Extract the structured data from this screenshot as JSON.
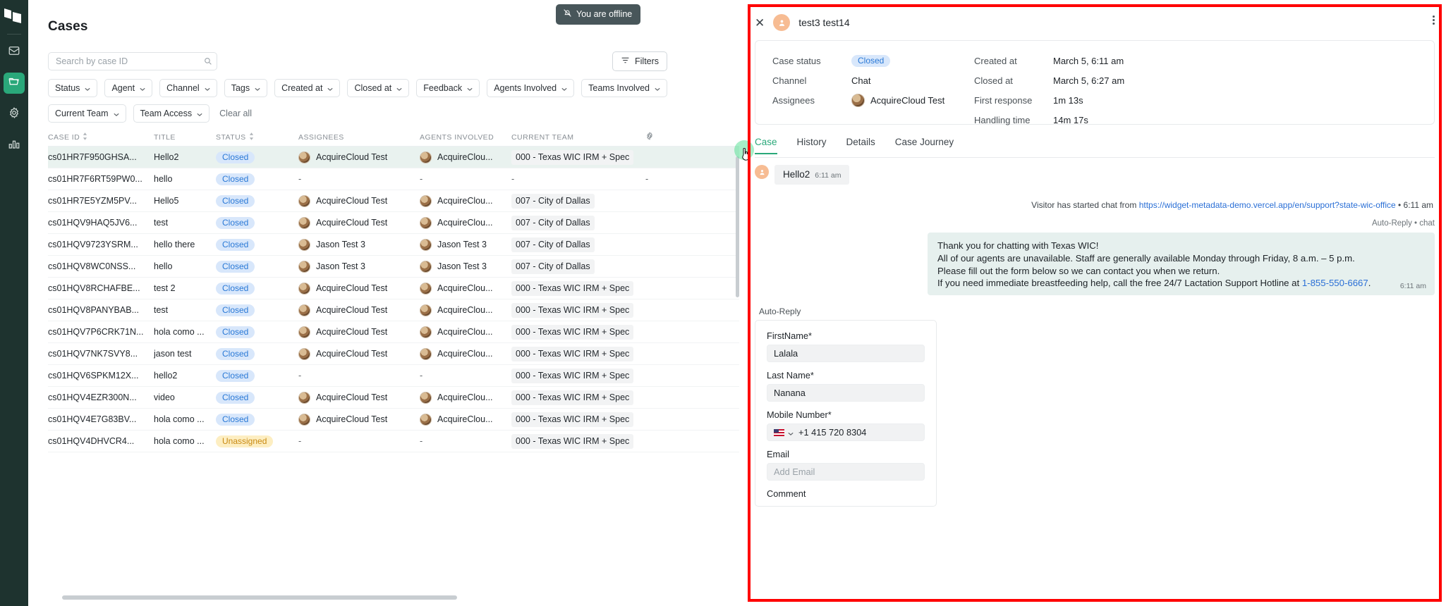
{
  "app": {
    "logo_icon": "acquire-logo-icon",
    "rail_items": [
      {
        "name": "inbox",
        "icon": "envelope-icon",
        "active": false
      },
      {
        "name": "cases",
        "icon": "folder-open-icon",
        "active": true
      },
      {
        "name": "settings",
        "icon": "gear-icon",
        "active": false
      },
      {
        "name": "analytics",
        "icon": "bar-chart-icon",
        "active": false
      }
    ]
  },
  "header": {
    "title": "Cases",
    "offline_label": "You are offline",
    "offline_icon": "bell-slash-icon"
  },
  "search": {
    "placeholder": "Search by case ID",
    "value": "",
    "icon": "search-icon"
  },
  "filters_button": {
    "label": "Filters",
    "icon": "filter-icon"
  },
  "filter_chips_row1": [
    "Status",
    "Agent",
    "Channel",
    "Tags",
    "Created at",
    "Closed at",
    "Feedback",
    "Agents Involved",
    "Teams Involved"
  ],
  "filter_chips_row2": [
    "Current Team",
    "Team Access"
  ],
  "clear_all_label": "Clear all",
  "table": {
    "columns": [
      "CASE ID",
      "TITLE",
      "STATUS",
      "ASSIGNEES",
      "AGENTS INVOLVED",
      "CURRENT TEAM"
    ],
    "sortable": [
      "CASE ID",
      "STATUS"
    ],
    "settings_icon": "gear-icon",
    "rows": [
      {
        "id": "cs01HR7F950GHSA...",
        "title": "Hello2",
        "status": "Closed",
        "assignee": "AcquireCloud Test",
        "agent": "AcquireClou...",
        "team": "000 - Texas WIC IRM + Spec",
        "selected": true
      },
      {
        "id": "cs01HR7F6RT59PW0...",
        "title": "hello",
        "status": "Closed",
        "assignee": "-",
        "agent": "-",
        "team": "-",
        "selected": false
      },
      {
        "id": "cs01HR7E5YZM5PV...",
        "title": "Hello5",
        "status": "Closed",
        "assignee": "AcquireCloud Test",
        "agent": "AcquireClou...",
        "team": "007 - City of Dallas",
        "selected": false
      },
      {
        "id": "cs01HQV9HAQ5JV6...",
        "title": "test",
        "status": "Closed",
        "assignee": "AcquireCloud Test",
        "agent": "AcquireClou...",
        "team": "007 - City of Dallas",
        "selected": false
      },
      {
        "id": "cs01HQV9723YSRM...",
        "title": "hello there",
        "status": "Closed",
        "assignee": "Jason Test 3",
        "agent": "Jason Test 3",
        "team": "007 - City of Dallas",
        "selected": false
      },
      {
        "id": "cs01HQV8WC0NSS...",
        "title": "hello",
        "status": "Closed",
        "assignee": "Jason Test 3",
        "agent": "Jason Test 3",
        "team": "007 - City of Dallas",
        "selected": false
      },
      {
        "id": "cs01HQV8RCHAFBE...",
        "title": "test 2",
        "status": "Closed",
        "assignee": "AcquireCloud Test",
        "agent": "AcquireClou...",
        "team": "000 - Texas WIC IRM + Spec",
        "selected": false
      },
      {
        "id": "cs01HQV8PANYBAB...",
        "title": "test",
        "status": "Closed",
        "assignee": "AcquireCloud Test",
        "agent": "AcquireClou...",
        "team": "000 - Texas WIC IRM + Spec",
        "selected": false
      },
      {
        "id": "cs01HQV7P6CRK71N...",
        "title": "hola como ...",
        "status": "Closed",
        "assignee": "AcquireCloud Test",
        "agent": "AcquireClou...",
        "team": "000 - Texas WIC IRM + Spec",
        "selected": false
      },
      {
        "id": "cs01HQV7NK7SVY8...",
        "title": "jason test",
        "status": "Closed",
        "assignee": "AcquireCloud Test",
        "agent": "AcquireClou...",
        "team": "000 - Texas WIC IRM + Spec",
        "selected": false
      },
      {
        "id": "cs01HQV6SPKM12X...",
        "title": "hello2",
        "status": "Closed",
        "assignee": "-",
        "agent": "-",
        "team": "000 - Texas WIC IRM + Spec",
        "selected": false
      },
      {
        "id": "cs01HQV4EZR300N...",
        "title": "video",
        "status": "Closed",
        "assignee": "AcquireCloud Test",
        "agent": "AcquireClou...",
        "team": "000 - Texas WIC IRM + Spec",
        "selected": false
      },
      {
        "id": "cs01HQV4E7G83BV...",
        "title": "hola como ...",
        "status": "Closed",
        "assignee": "AcquireCloud Test",
        "agent": "AcquireClou...",
        "team": "000 - Texas WIC IRM + Spec",
        "selected": false
      },
      {
        "id": "cs01HQV4DHVCR4...",
        "title": "hola como ...",
        "status": "Unassigned",
        "assignee": "-",
        "agent": "-",
        "team": "000 - Texas WIC IRM + Spec",
        "selected": false
      }
    ]
  },
  "detail": {
    "contact_name": "test3 test14",
    "close_icon": "close-icon",
    "avatar_icon": "person-icon",
    "menu_icon": "kebab-menu-icon",
    "meta_left": [
      {
        "key": "Case status",
        "value": "Closed",
        "type": "badge"
      },
      {
        "key": "Channel",
        "value": "Chat",
        "type": "text"
      },
      {
        "key": "Assignees",
        "value": "AcquireCloud Test",
        "type": "avatar"
      }
    ],
    "meta_right": [
      {
        "key": "Created at",
        "value": "March 5, 6:11 am"
      },
      {
        "key": "Closed at",
        "value": "March 5, 6:27 am"
      },
      {
        "key": "First response",
        "value": "1m 13s"
      },
      {
        "key": "Handling time",
        "value": "14m 17s"
      }
    ],
    "tabs": [
      {
        "label": "Case",
        "active": true
      },
      {
        "label": "History",
        "active": false
      },
      {
        "label": "Details",
        "active": false
      },
      {
        "label": "Case Journey",
        "active": false
      }
    ],
    "chat": {
      "first_message": "Hello2",
      "first_message_time": "6:11 am",
      "system_prefix": "Visitor has started chat from ",
      "system_link": "https://widget-metadata-demo.vercel.app/en/support?state-wic-office",
      "system_suffix": " • 6:11 am",
      "autoreply_tag": "Auto-Reply • chat",
      "bubble_line1": "Thank you for chatting with Texas WIC!",
      "bubble_line2": "All of our agents are unavailable. Staff are generally available Monday through Friday, 8 a.m. – 5 p.m.",
      "bubble_line3": "Please fill out the form below so we can contact you when we return.",
      "bubble_line4_pre": "If you need immediate breastfeeding help, call the free 24/7 Lactation Support Hotline at ",
      "bubble_line4_link": "1-855-550-6667",
      "bubble_line4_post": ".",
      "bubble_time": "6:11 am",
      "agent_badge_icon": "acquire-logo-icon"
    },
    "form": {
      "section_label": "Auto-Reply",
      "fields": [
        {
          "label": "FirstName*",
          "value": "Lalala",
          "placeholder": "",
          "type": "text"
        },
        {
          "label": "Last Name*",
          "value": "Nanana",
          "placeholder": "",
          "type": "text"
        },
        {
          "label": "Mobile Number*",
          "value": "+1 415 720 8304",
          "placeholder": "",
          "type": "phone",
          "flag": "us-flag-icon"
        },
        {
          "label": "Email",
          "value": "",
          "placeholder": "Add Email",
          "type": "text"
        }
      ],
      "comment_label": "Comment"
    }
  },
  "colors": {
    "accent_green": "#2aa87a",
    "rail_dark": "#1e332f",
    "badge_closed_bg": "#d8e7fb",
    "badge_closed_fg": "#2a79d6",
    "badge_unassigned_bg": "#fdeec2",
    "badge_unassigned_fg": "#c98a12",
    "highlight_outline": "#ff0000",
    "link_blue": "#2a6fd6"
  }
}
